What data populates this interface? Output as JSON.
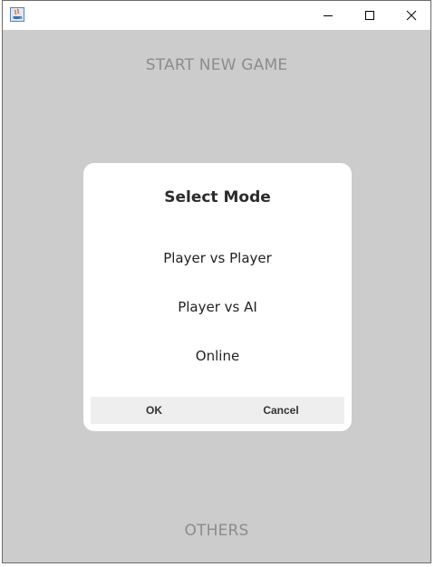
{
  "window": {
    "icon": "java-app-icon",
    "controls": {
      "minimize": "minimize-icon",
      "maximize": "maximize-icon",
      "close": "close-icon"
    }
  },
  "menu": {
    "start_new_game": "START NEW GAME",
    "others": "OTHERS"
  },
  "dialog": {
    "title": "Select Mode",
    "options": [
      "Player vs Player",
      "Player vs AI",
      "Online"
    ],
    "ok_label": "OK",
    "cancel_label": "Cancel"
  },
  "colors": {
    "background": "#cccccc",
    "menu_text": "#8c8c8c",
    "dialog_bg": "#ffffff",
    "button_bar": "#eeeeee"
  }
}
